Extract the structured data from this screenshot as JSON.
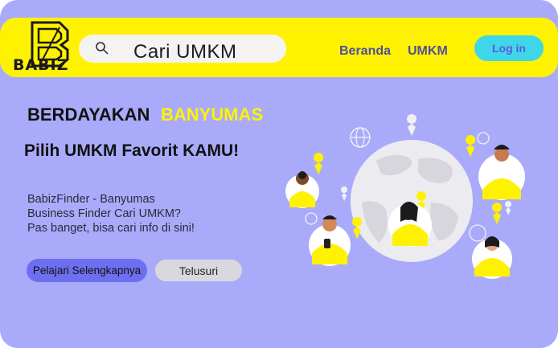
{
  "brand": {
    "logo_text": "BABIZ"
  },
  "search": {
    "placeholder": "Cari UMKM"
  },
  "nav": {
    "items": [
      "Beranda",
      "UMKM"
    ],
    "login_label": "Log in"
  },
  "hero": {
    "title_part1": "BERDAYAKAN",
    "title_part2": "BANYUMAS",
    "subtitle": "Pilih UMKM Favorit KAMU!",
    "description_lines": [
      "BabizFinder - Banyumas",
      "Business Finder  Cari UMKM?",
      "Pas banget, bisa cari info di sini!"
    ],
    "primary_button": "Pelajari Selengkapnya",
    "secondary_button": "Telusuri"
  },
  "icons": [
    "logo-b-icon",
    "search-icon",
    "globe-icon",
    "map-pin-icon",
    "chat-bubble-icon",
    "person-illustration"
  ],
  "colors": {
    "background": "#a9abfa",
    "navbar": "#fef200",
    "accent_yellow": "#fef200",
    "login_button": "#3fd6ea",
    "primary_button": "#6e6ff0"
  }
}
